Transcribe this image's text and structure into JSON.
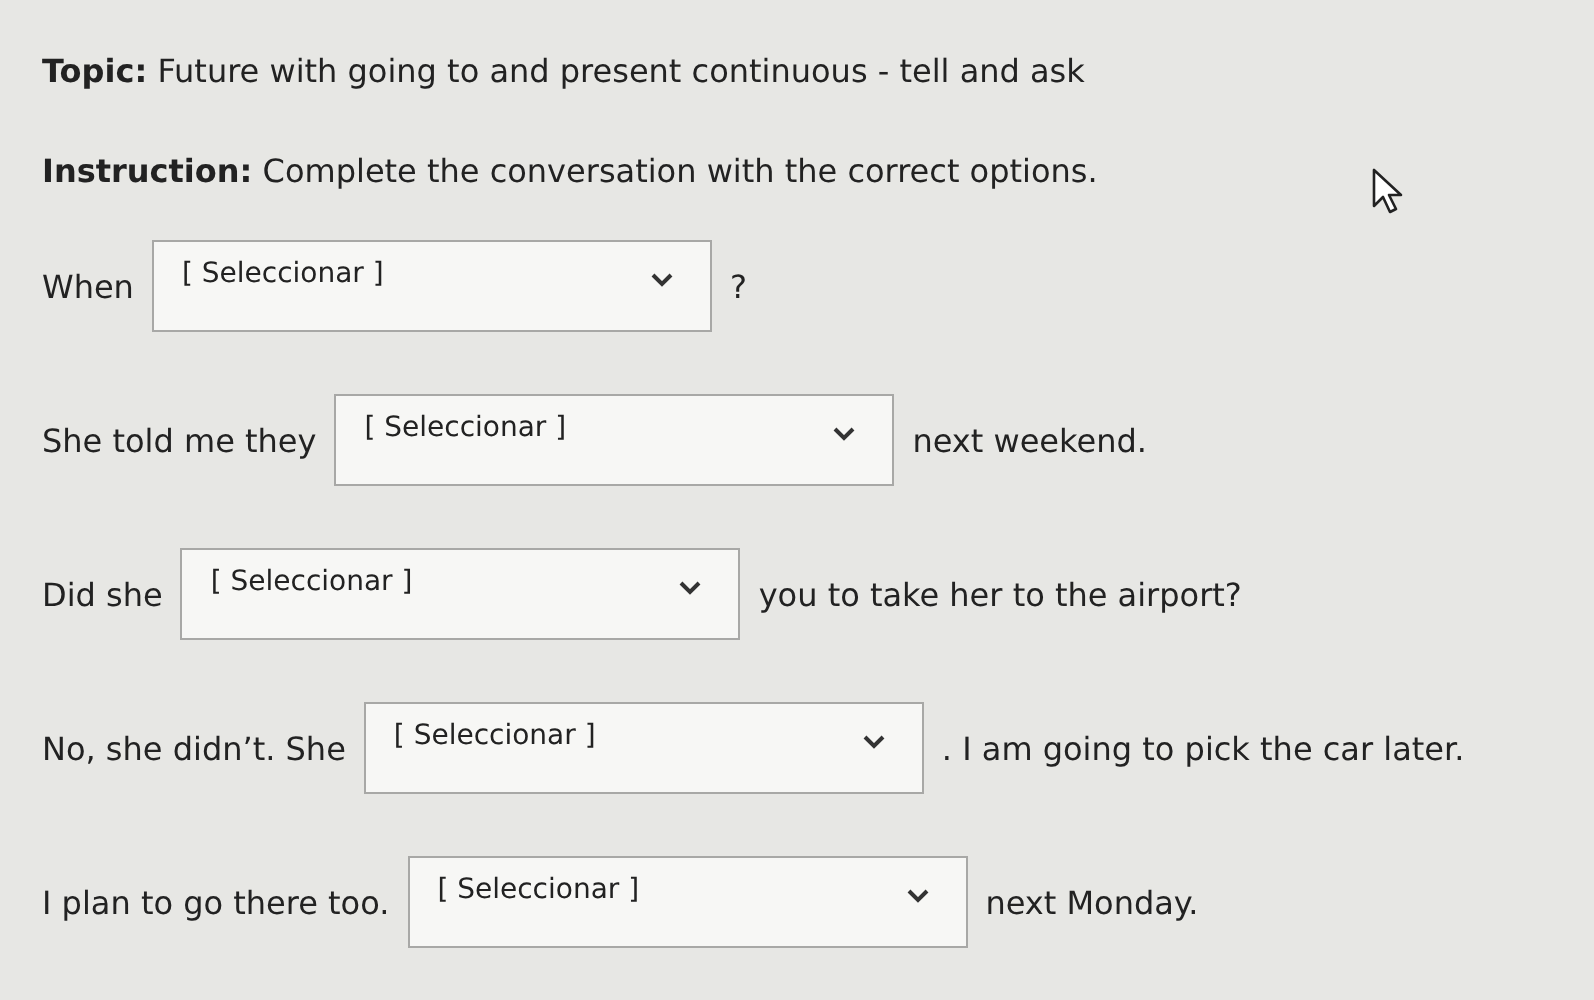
{
  "topic": "**Topic:** Future with going to and present continuous - tell and ask",
  "instruction": "**Instruction:** Complete the conversation with the correct options.",
  "questions": [
    {
      "before": "When",
      "dropdown": {
        "value": "[ Seleccionar ]"
      },
      "after": "?"
    },
    {
      "before": "She told me they",
      "dropdown": {
        "value": "[ Seleccionar ]"
      },
      "after": "next weekend."
    },
    {
      "before": "Did she",
      "dropdown": {
        "value": "[ Seleccionar ]"
      },
      "after": "you to take her to the airport?"
    },
    {
      "before": "No, she didn’t. She",
      "dropdown": {
        "value": "[ Seleccionar ]"
      },
      "after": ". I am going to pick the car later."
    },
    {
      "before": "I plan to go there too.",
      "dropdown": {
        "value": "[ Seleccionar ]"
      },
      "after": "next Monday."
    }
  ]
}
